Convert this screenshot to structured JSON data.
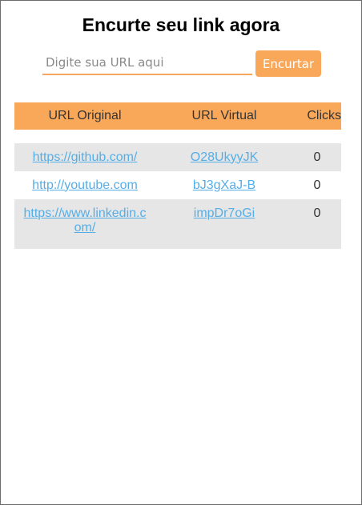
{
  "header": {
    "title": "Encurte seu link agora"
  },
  "form": {
    "placeholder": "Digite sua URL aqui",
    "value": "",
    "button_label": "Encurtar"
  },
  "table": {
    "columns": [
      "URL Original",
      "URL Virtual",
      "Clicks"
    ],
    "rows": [
      {
        "original": "https://github.com/",
        "virtual": "O28UkyyJK",
        "clicks": "0"
      },
      {
        "original": "http://youtube.com",
        "virtual": "bJ3gXaJ-B",
        "clicks": "0"
      },
      {
        "original": "https://www.linkedin.com/",
        "virtual": "impDr7oGi",
        "clicks": "0"
      }
    ]
  },
  "colors": {
    "accent": "#f9a85a",
    "link": "#55aee8",
    "row_stripe": "#e6e6e6"
  }
}
